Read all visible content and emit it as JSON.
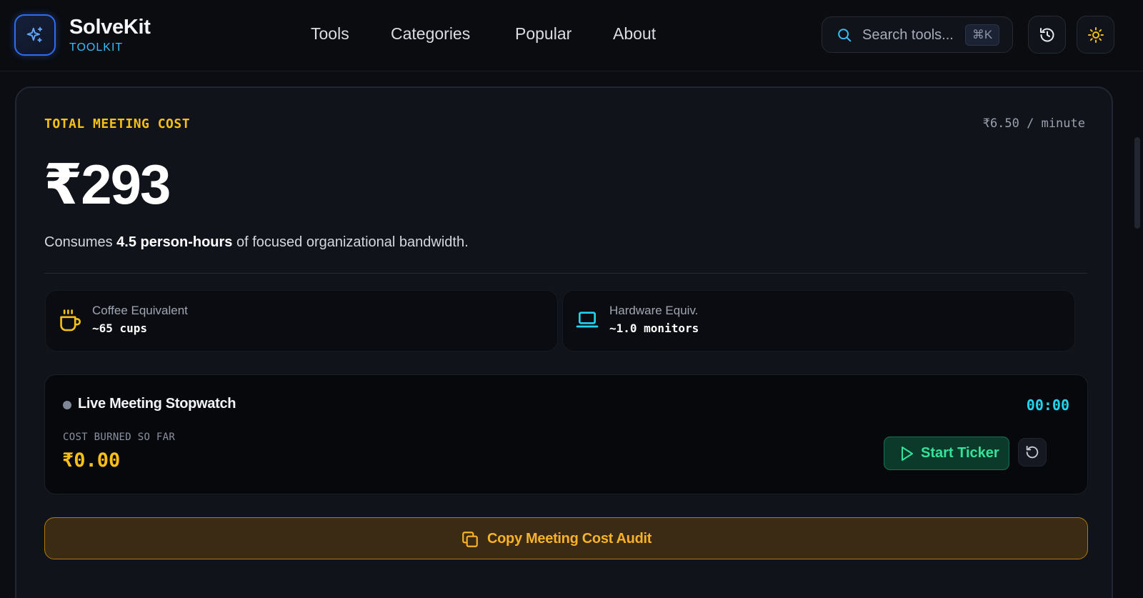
{
  "header": {
    "brand_name": "SolveKit",
    "brand_sub": "TOOLKIT",
    "nav": [
      "Tools",
      "Categories",
      "Popular",
      "About"
    ],
    "search": {
      "placeholder": "Search tools...",
      "shortcut": "⌘K"
    },
    "icons": {
      "logo": "sparkle-icon",
      "history": "history-icon",
      "theme": "sun-icon"
    }
  },
  "cost": {
    "label": "TOTAL MEETING COST",
    "rate": "₹6.50 / minute",
    "amount": "₹293",
    "consumes_prefix": "Consumes ",
    "consumes_bold": "4.5 person-hours",
    "consumes_suffix": " of focused organizational bandwidth."
  },
  "equivalents": [
    {
      "icon": "coffee-cup-icon",
      "title": "Coffee Equivalent",
      "value": "~65 cups",
      "color": "#f6c018"
    },
    {
      "icon": "laptop-icon",
      "title": "Hardware Equiv.",
      "value": "~1.0 monitors",
      "color": "#22d3ee"
    }
  ],
  "stopwatch": {
    "title": "Live Meeting Stopwatch",
    "time": "00:00",
    "burned_label": "COST BURNED SO FAR",
    "burned_amount": "₹0.00",
    "start_label": "Start Ticker"
  },
  "copy_button": {
    "label": "Copy Meeting Cost Audit"
  },
  "colors": {
    "accent_yellow": "#f6c018",
    "accent_cyan": "#22d3ee",
    "accent_green": "#34e39a",
    "background": "#0b0d12",
    "card": "#10131a"
  }
}
